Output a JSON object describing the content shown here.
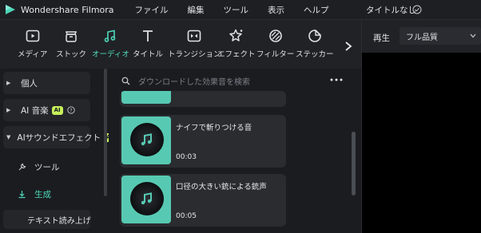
{
  "app": {
    "name": "Wondershare Filmora",
    "doc_title": "タイトルなし"
  },
  "menu": [
    "ファイル",
    "編集",
    "ツール",
    "表示",
    "ヘルプ"
  ],
  "toolbar": {
    "items": [
      {
        "label": "メディア",
        "icon": "media-icon"
      },
      {
        "label": "ストック",
        "icon": "stock-icon"
      },
      {
        "label": "オーディオ",
        "icon": "audio-icon",
        "active": true
      },
      {
        "label": "タイトル",
        "icon": "title-icon"
      },
      {
        "label": "トランジション",
        "icon": "transition-icon"
      },
      {
        "label": "エフェクト",
        "icon": "effect-icon"
      },
      {
        "label": "フィルター",
        "icon": "filter-icon"
      },
      {
        "label": "ステッカー",
        "icon": "sticker-icon"
      }
    ]
  },
  "preview": {
    "play_label": "再生",
    "quality": "フル品質"
  },
  "sidebar": {
    "personal": "個人",
    "ai_music": "AI 音楽",
    "ai_badge": "AI",
    "ai_sound_effect": "AIサウンドエフェクト",
    "tool": "ツール",
    "generate": "生成",
    "tts": "テキスト読み上げ"
  },
  "search": {
    "placeholder": "ダウンロードした効果音を検索"
  },
  "cards": [
    {
      "title": "ナイフで斬りつける音",
      "duration": "00:03"
    },
    {
      "title": "口径の大きい銃による銃声",
      "duration": "00:05"
    }
  ],
  "colors": {
    "accent": "#4fd6b8",
    "badge": "#c7ef5a",
    "thumb": "#57c9b2"
  }
}
